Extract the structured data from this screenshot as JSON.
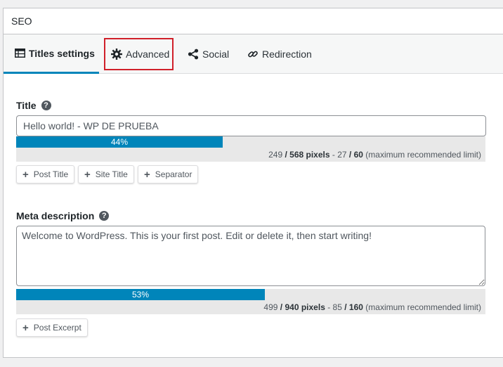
{
  "panel": {
    "title": "SEO"
  },
  "tabs": [
    {
      "label": "Titles settings",
      "icon": "table-icon",
      "active": true
    },
    {
      "label": "Advanced",
      "icon": "gear-icon",
      "active": false
    },
    {
      "label": "Social",
      "icon": "share-icon",
      "active": false
    },
    {
      "label": "Redirection",
      "icon": "link-icon",
      "active": false
    }
  ],
  "title_field": {
    "label": "Title",
    "help": "?",
    "value": "Hello world! - WP DE PRUEBA",
    "progress_label": "44%",
    "progress_fraction": 0.44,
    "pixels_used": "249",
    "pixels_max": "568",
    "pixels_word": "pixels",
    "chars_used": "27",
    "chars_max": "60",
    "limit_note": "(maximum recommended limit)",
    "tag_buttons": [
      "Post Title",
      "Site Title",
      "Separator"
    ]
  },
  "meta_field": {
    "label": "Meta description",
    "help": "?",
    "value": "Welcome to WordPress. This is your first post. Edit or delete it, then start writing!",
    "progress_label": "53%",
    "progress_fraction": 0.53,
    "pixels_used": "499",
    "pixels_max": "940",
    "pixels_word": "pixels",
    "chars_used": "85",
    "chars_max": "160",
    "limit_note": "(maximum recommended limit)",
    "tag_buttons": [
      "Post Excerpt"
    ]
  },
  "colors": {
    "accent": "#0085ba",
    "highlight": "#d0202a"
  }
}
